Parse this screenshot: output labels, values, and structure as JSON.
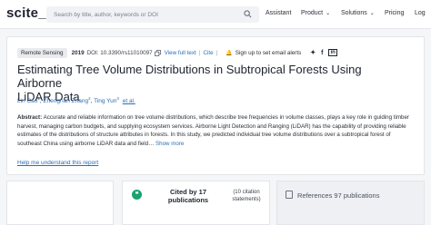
{
  "header": {
    "logo": "scite_",
    "search_placeholder": "Search by title, author, keywords or DOI",
    "nav": [
      "Assistant",
      "Product",
      "Solutions",
      "Pricing",
      "Log"
    ]
  },
  "paper": {
    "tag": "Remote Sensing",
    "year": "2019",
    "doi": "DOI: 10.3390/rs11010097",
    "view_full_text": "View full text",
    "cite": "Cite",
    "alerts": "Sign up to set email alerts",
    "title_line1": "Estimating Tree Volume Distributions in Subtropical Forests Using Airborne",
    "title_line2": "LiDAR Data",
    "authors": [
      {
        "name": "Lin Cao",
        "sup": "1"
      },
      {
        "name": "Zhengnan Zhang",
        "sup": "2"
      },
      {
        "name": "Ting Yun",
        "sup": "3"
      }
    ],
    "et_al": "et al.",
    "abstract_label": "Abstract:",
    "abstract_text": "Accurate and reliable information on tree volume distributions, which describe tree frequencies in volume classes, plays a key role in guiding timber harvest, managing carbon budgets, and supplying ecosystem services. Airborne Light Detection and Ranging (LiDAR) has the capability of providing reliable estimates of the distributions of structure attributes in forests. In this study, we predicted individual tree volume distributions over a subtropical forest of southeast China using airborne LiDAR data and field…",
    "show_more": "Show more",
    "help_link": "Help me understand this report"
  },
  "stats": {
    "cited_label": "Cited by 17 publications",
    "cited_sub": "(10 citation statements)",
    "refs_label": "References 97 publications"
  },
  "colors": {
    "link": "#2a6fb8",
    "cite_icon_bg": "#1aa36f"
  }
}
